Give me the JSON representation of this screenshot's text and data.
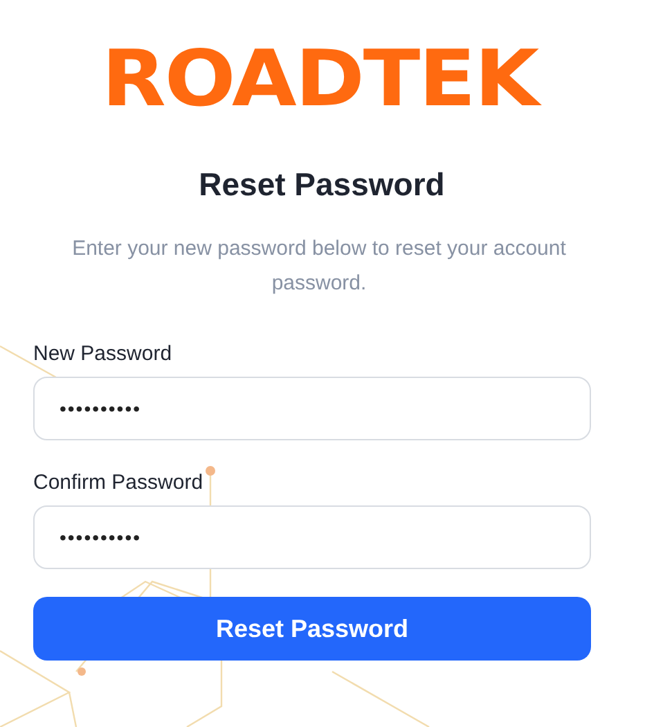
{
  "logo": {
    "text": "ROADTEK"
  },
  "title": "Reset Password",
  "subtitle": "Enter your new password below to reset your account password.",
  "fields": [
    {
      "label": "New Password",
      "value": "••••••••••"
    },
    {
      "label": "Confirm Password",
      "value": "••••••••••"
    }
  ],
  "submit_button": {
    "label": "Reset Password"
  }
}
